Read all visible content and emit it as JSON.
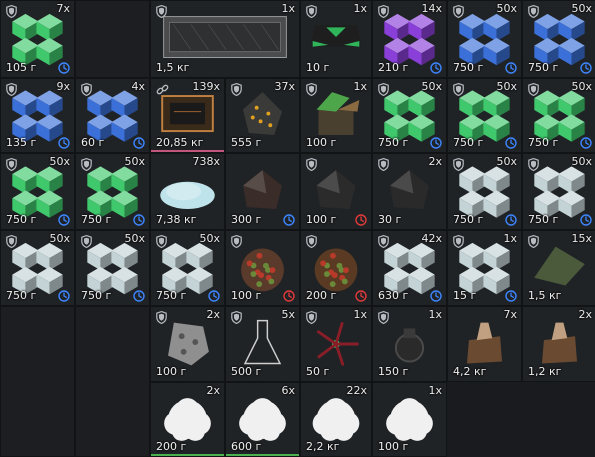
{
  "colors": {
    "blue": "#3d86ff",
    "red": "#e03a3a",
    "bar_pink": "#c2557c",
    "bar_green": "#4caf50"
  },
  "slots": [
    {
      "count": "7x",
      "weight": "105 г",
      "icon": "green-crystal-icon",
      "color": "#3fc86c",
      "timer": "blue",
      "shield": true
    },
    {
      "empty": true
    },
    {
      "count": "1x",
      "weight": "1,5 кг",
      "icon": "glass-case-icon",
      "color": "#7a7c7e",
      "shield": true,
      "wide": true
    },
    {
      "count": "1x",
      "weight": "10 г",
      "icon": "green-device-icon",
      "color": "#2fb45a",
      "shield": true
    },
    {
      "count": "14x",
      "weight": "210 г",
      "icon": "purple-crystal-icon",
      "color": "#8a3fd8",
      "timer": "blue",
      "shield": true
    },
    {
      "count": "50x",
      "weight": "750 г",
      "icon": "blue-crystal-icon",
      "color": "#3a70d8",
      "timer": "blue",
      "shield": true
    },
    {
      "count": "50x",
      "weight": "750 г",
      "icon": "blue-crystal-icon",
      "color": "#3a70d8",
      "timer": "blue",
      "shield": true
    },
    {
      "count": "9x",
      "weight": "135 г",
      "icon": "blue-crystal-icon",
      "color": "#3a70d8",
      "timer": "blue",
      "shield": true
    },
    {
      "count": "4x",
      "weight": "60 г",
      "icon": "blue-crystal-icon",
      "color": "#3a70d8",
      "timer": "blue",
      "shield": true
    },
    {
      "count": "139x",
      "weight": "20,85 кг",
      "icon": "circuit-board-icon",
      "color": "#8a5a2a",
      "link": true,
      "bar": "pink"
    },
    {
      "count": "37x",
      "weight": "555 г",
      "icon": "gold-ore-icon",
      "color": "#3a3a38",
      "shield": true
    },
    {
      "count": "1x",
      "weight": "100 г",
      "icon": "open-box-icon",
      "color": "#4da64a",
      "shield": true
    },
    {
      "count": "50x",
      "weight": "750 г",
      "icon": "green-crystal-icon",
      "color": "#3fc86c",
      "timer": "blue",
      "shield": true
    },
    {
      "count": "50x",
      "weight": "750 г",
      "icon": "green-crystal-icon",
      "color": "#3fc86c",
      "timer": "blue",
      "shield": true
    },
    {
      "count": "50x",
      "weight": "750 г",
      "icon": "green-crystal-icon",
      "color": "#3fc86c",
      "timer": "blue",
      "shield": true
    },
    {
      "count": "50x",
      "weight": "750 г",
      "icon": "green-crystal-icon",
      "color": "#3fc86c",
      "timer": "blue",
      "shield": true
    },
    {
      "count": "50x",
      "weight": "750 г",
      "icon": "green-crystal-icon",
      "color": "#3fc86c",
      "timer": "blue",
      "shield": true
    },
    {
      "count": "738x",
      "weight": "7,38 кг",
      "icon": "salt-pile-icon",
      "color": "#bfe3ea",
      "shield": false
    },
    {
      "count": "",
      "weight": "300 г",
      "icon": "dark-husk-icon",
      "color": "#3a2c28",
      "timer": "blue",
      "shield": false
    },
    {
      "count": "",
      "weight": "100 г",
      "icon": "black-fruit-icon",
      "color": "#2b2b2b",
      "timer": "red",
      "shield": true
    },
    {
      "count": "2x",
      "weight": "30 г",
      "icon": "black-rock-icon",
      "color": "#2a2a2a",
      "shield": true
    },
    {
      "count": "50x",
      "weight": "750 г",
      "icon": "white-crystal-icon",
      "color": "#c3d3d6",
      "timer": "blue",
      "shield": true
    },
    {
      "count": "50x",
      "weight": "750 г",
      "icon": "white-crystal-icon",
      "color": "#c3d3d6",
      "timer": "blue",
      "shield": true
    },
    {
      "count": "50x",
      "weight": "750 г",
      "icon": "white-crystal-icon",
      "color": "#c3d3d6",
      "timer": "blue",
      "shield": true
    },
    {
      "count": "50x",
      "weight": "750 г",
      "icon": "white-crystal-icon",
      "color": "#c3d3d6",
      "timer": "blue",
      "shield": true
    },
    {
      "count": "50x",
      "weight": "750 г",
      "icon": "white-crystal-icon",
      "color": "#c3d3d6",
      "timer": "blue",
      "shield": true
    },
    {
      "count": "",
      "weight": "100 г",
      "icon": "red-berries-icon",
      "color": "#5a3a2a",
      "timer": "red",
      "shield": true
    },
    {
      "count": "",
      "weight": "200 г",
      "icon": "red-moss-icon",
      "color": "#5a3a22",
      "timer": "red",
      "shield": true
    },
    {
      "count": "42x",
      "weight": "630 г",
      "icon": "white-crystal-icon",
      "color": "#c3d3d6",
      "timer": "blue",
      "shield": true
    },
    {
      "count": "1x",
      "weight": "15 г",
      "icon": "white-crystal-icon",
      "color": "#c3d3d6",
      "timer": "blue",
      "shield": true
    },
    {
      "count": "15x",
      "weight": "1,5 кг",
      "icon": "green-cloth-icon",
      "color": "#4a5a3a",
      "shield": true
    },
    {
      "empty": true
    },
    {
      "empty": true
    },
    {
      "count": "2x",
      "weight": "100 г",
      "icon": "grey-rock-icon",
      "color": "#8f8f8f",
      "shield": true
    },
    {
      "count": "5x",
      "weight": "500 г",
      "icon": "flask-icon",
      "color": "#cfcfcf",
      "shield": true
    },
    {
      "count": "1x",
      "weight": "50 г",
      "icon": "red-tentacle-icon",
      "color": "#8a1e28",
      "shield": true
    },
    {
      "count": "1x",
      "weight": "150 г",
      "icon": "dark-device-icon",
      "color": "#333",
      "shield": true
    },
    {
      "count": "7x",
      "weight": "4,2 кг",
      "icon": "leather-bag-icon",
      "color": "#6a4a30",
      "shield": false
    },
    {
      "count": "2x",
      "weight": "1,2 кг",
      "icon": "leather-bag-icon",
      "color": "#6a4a30",
      "shield": false
    },
    {
      "count": "2x",
      "weight": "200 г",
      "icon": "white-puff-icon",
      "color": "#f0f0f0",
      "shield": false,
      "bar": "green"
    },
    {
      "count": "6x",
      "weight": "600 г",
      "icon": "white-puff-icon",
      "color": "#f0f0f0",
      "shield": false,
      "bar": "green"
    },
    {
      "count": "22x",
      "weight": "2,2 кг",
      "icon": "white-puff-icon",
      "color": "#f0f0f0",
      "shield": false
    },
    {
      "count": "1x",
      "weight": "100 г",
      "icon": "white-puff-icon",
      "color": "#f0f0f0",
      "shield": false
    }
  ]
}
